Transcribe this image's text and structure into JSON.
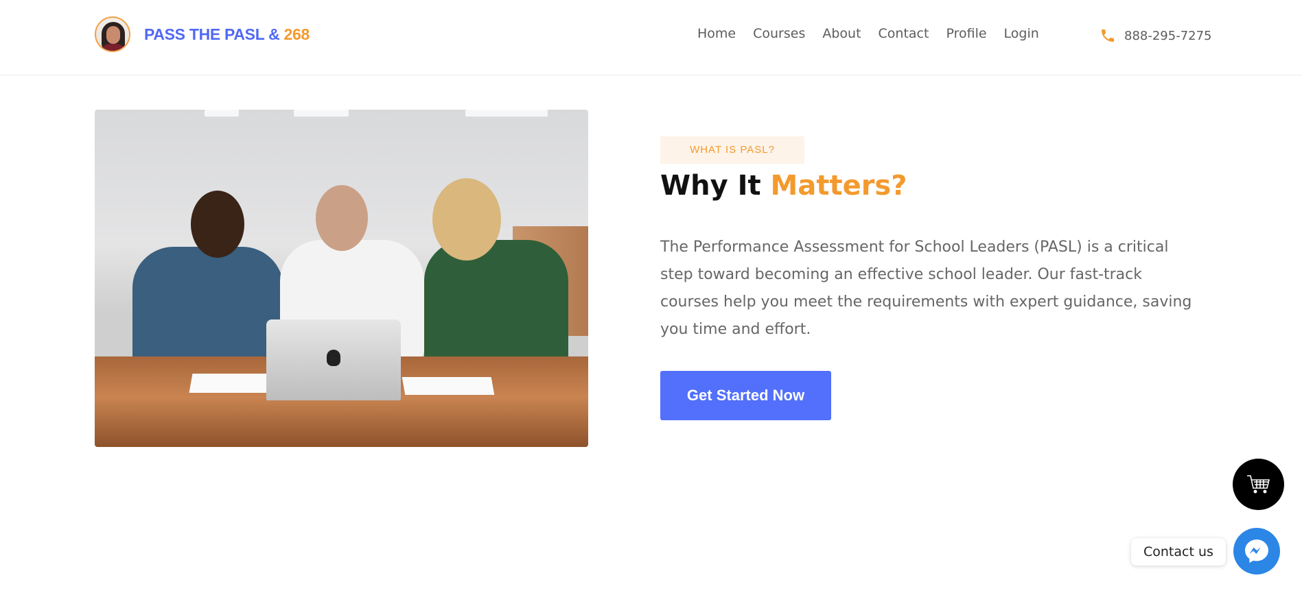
{
  "header": {
    "brand_main": "PASS THE PASL & ",
    "brand_accent": "268",
    "nav": {
      "home": "Home",
      "courses": "Courses",
      "about": "About",
      "contact": "Contact",
      "profile": "Profile",
      "login": "Login"
    },
    "phone": "888-295-7275"
  },
  "section": {
    "tag": "WHAT IS PASL?",
    "title_main": "Why It ",
    "title_accent": "Matters?",
    "description": "The Performance Assessment for School Leaders (PASL) is a critical step toward becoming an effective school leader. Our fast-track courses help you meet the requirements with expert guidance, saving you time and effort.",
    "cta_label": "Get Started Now"
  },
  "widgets": {
    "contact_label": "Contact us",
    "cart_icon": "cart-icon",
    "messenger_icon": "messenger-icon"
  },
  "colors": {
    "brand_blue": "#5068f5",
    "accent_orange": "#f39a2e",
    "cta_blue": "#5270fb",
    "messenger_blue": "#2c86e6"
  }
}
